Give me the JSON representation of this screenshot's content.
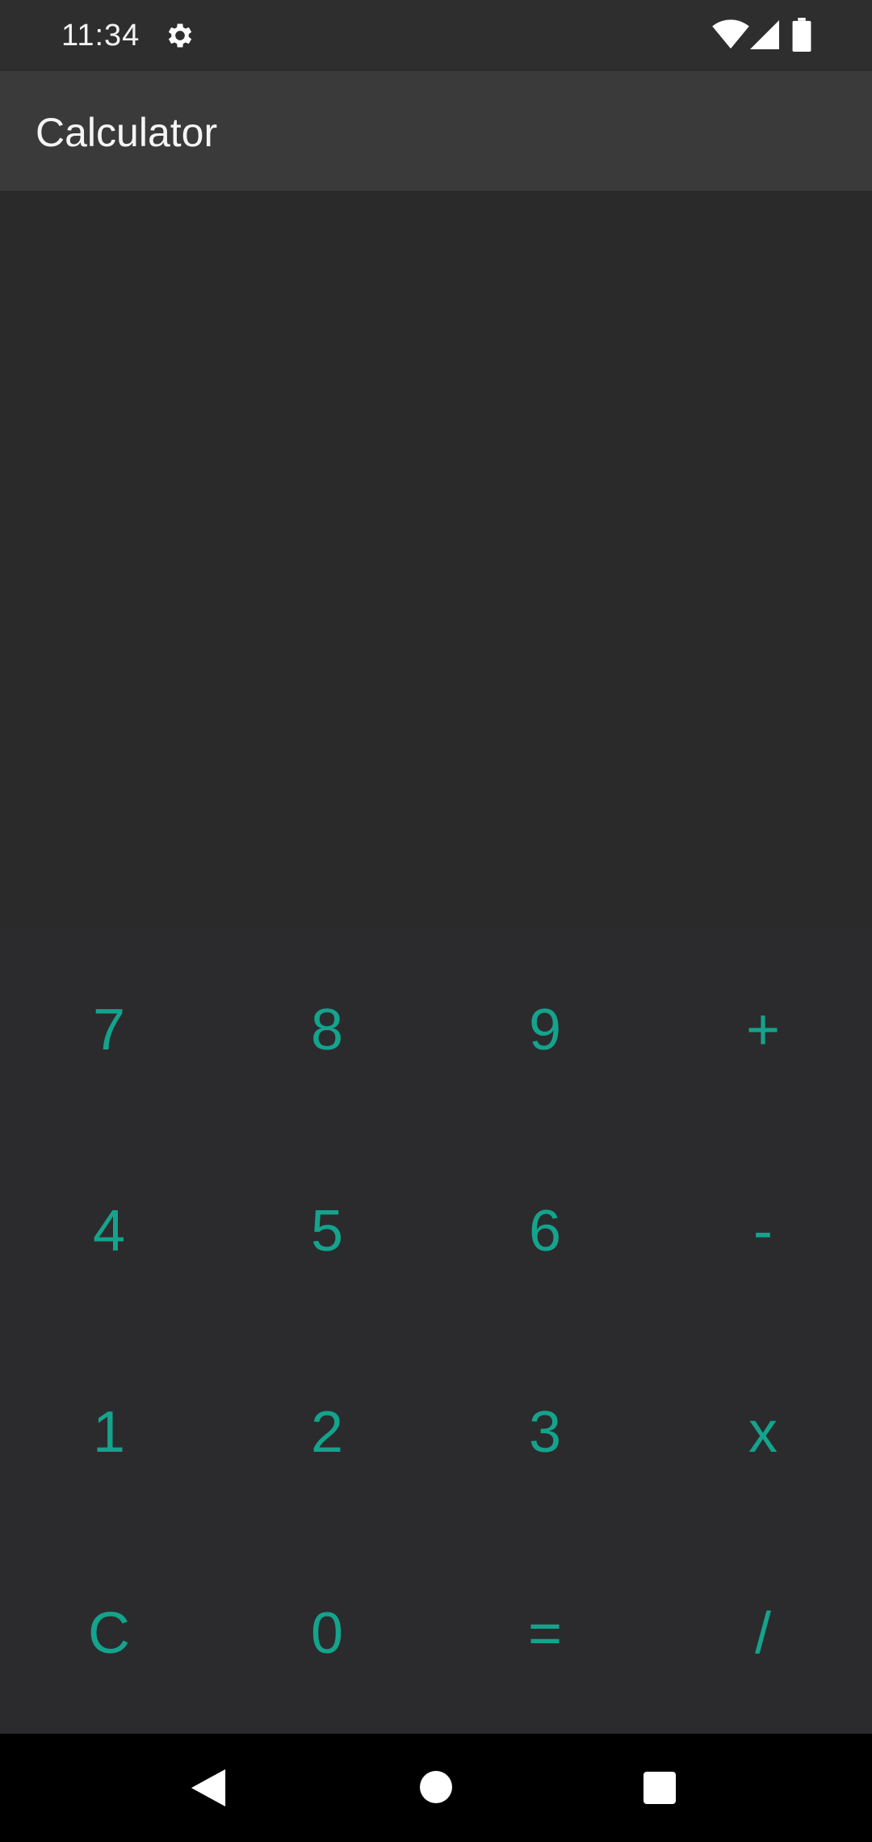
{
  "status_bar": {
    "time": "11:34",
    "icons": [
      "gear-icon",
      "wifi-icon",
      "signal-icon",
      "battery-icon"
    ]
  },
  "app_bar": {
    "title": "Calculator"
  },
  "display": {
    "value": ""
  },
  "keypad": {
    "keys": [
      {
        "label": "7"
      },
      {
        "label": "8"
      },
      {
        "label": "9"
      },
      {
        "label": "+"
      },
      {
        "label": "4"
      },
      {
        "label": "5"
      },
      {
        "label": "6"
      },
      {
        "label": "-"
      },
      {
        "label": "1"
      },
      {
        "label": "2"
      },
      {
        "label": "3"
      },
      {
        "label": "x"
      },
      {
        "label": "C"
      },
      {
        "label": "0"
      },
      {
        "label": "="
      },
      {
        "label": "/"
      }
    ]
  },
  "nav_bar": {
    "icons": [
      "back-icon",
      "home-icon",
      "recents-icon"
    ]
  },
  "colors": {
    "accent": "#14a38c",
    "background": "#2b2b2b",
    "app_bar": "#3a3a3a",
    "nav_bar": "#000000"
  }
}
